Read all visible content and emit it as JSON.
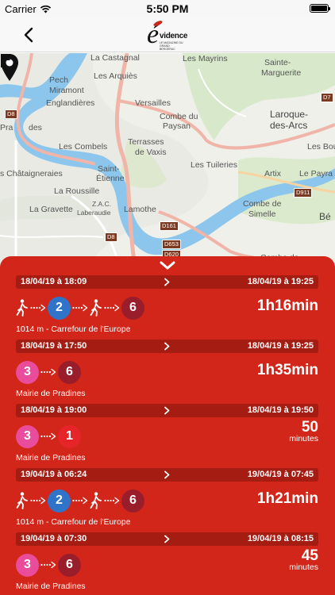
{
  "status_bar": {
    "carrier": "Carrier",
    "time": "5:50 PM"
  },
  "navbar": {
    "logo_text": "vidence",
    "logo_initial": "é",
    "logo_tagline": "LE MAGAZINE DU GRAND BERGERAC"
  },
  "map": {
    "labels": [
      "La Castagnal",
      "Les Mayrins",
      "Sainte-",
      "Marguerite",
      "Pech",
      "Miramont",
      "Les Arquiès",
      "Englandières",
      "Versailles",
      "Laroque-",
      "des-Arcs",
      "Combe du",
      "Paysan",
      "Pra",
      "des",
      "Les Combels",
      "Terrasses",
      "de Vaxis",
      "Saint-",
      "Étienne",
      "Les Bou",
      "Les Tuileries",
      "Artix",
      "Le Payra",
      "s Châtaigneraies",
      "La Roussille",
      "La Gravette",
      "Z.A.C.",
      "Laberaudie",
      "Lamothe",
      "Combe de",
      "Simelle",
      "Bé",
      "Combe de"
    ],
    "roads": [
      "D8",
      "D7",
      "D911",
      "D161",
      "D653",
      "D620",
      "D8"
    ]
  },
  "trips": [
    {
      "departure": "18/04/19 à 18:09",
      "arrival": "18/04/19 à 19:25",
      "legs": [
        "walk",
        "2",
        "walk",
        "6"
      ],
      "duration": "1h16min",
      "duration_unit": "",
      "stop": "1014 m - Carrefour de l'Europe"
    },
    {
      "departure": "18/04/19 à 17:50",
      "arrival": "18/04/19 à 19:25",
      "legs": [
        "3",
        "6"
      ],
      "duration": "1h35min",
      "duration_unit": "",
      "stop": "Mairie de Pradines"
    },
    {
      "departure": "18/04/19 à 19:00",
      "arrival": "18/04/19 à 19:50",
      "legs": [
        "3",
        "1"
      ],
      "duration": "50",
      "duration_unit": "minutes",
      "stop": "Mairie de Pradines"
    },
    {
      "departure": "19/04/19 à 06:24",
      "arrival": "19/04/19 à 07:45",
      "legs": [
        "walk",
        "2",
        "walk",
        "6"
      ],
      "duration": "1h21min",
      "duration_unit": "",
      "stop": "1014 m - Carrefour de l'Europe"
    },
    {
      "departure": "19/04/19 à 07:30",
      "arrival": "19/04/19 à 08:15",
      "legs": [
        "3",
        "6"
      ],
      "duration": "45",
      "duration_unit": "minutes",
      "stop": "Mairie de Pradines"
    }
  ],
  "colors": {
    "panel": "#d2261a",
    "time_bar": "#a41c12",
    "line_1": "#e5252a",
    "line_2": "#2f74c8",
    "line_3": "#e84c9a",
    "line_6": "#9a1d2b"
  }
}
